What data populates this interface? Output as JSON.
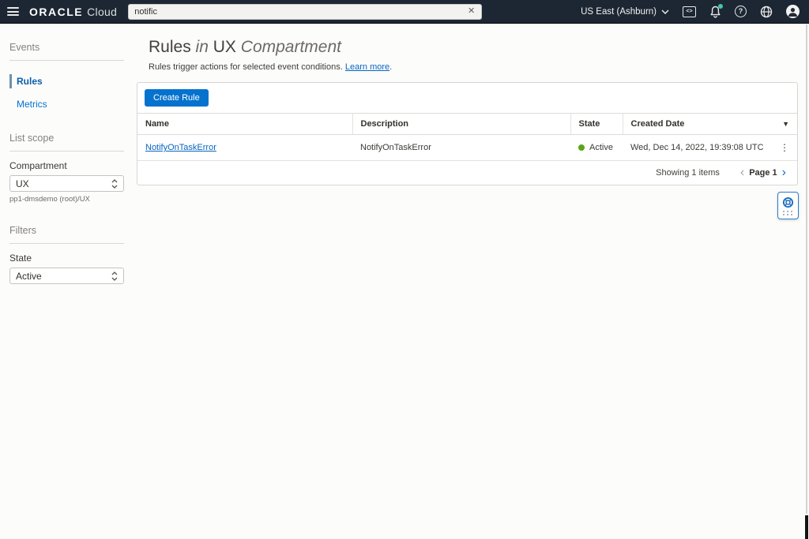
{
  "topbar": {
    "brand_bold": "ORACLE",
    "brand_light": "Cloud",
    "search": {
      "value": "notific"
    },
    "region_label": "US East (Ashburn)"
  },
  "sidebar": {
    "events_heading": "Events",
    "nav": [
      {
        "label": "Rules",
        "active": true
      },
      {
        "label": "Metrics",
        "active": false
      }
    ],
    "list_scope_heading": "List scope",
    "compartment_label": "Compartment",
    "compartment_value": "UX",
    "compartment_path": "pp1-dmsdemo (root)/UX",
    "filters_heading": "Filters",
    "state_label": "State",
    "state_value": "Active"
  },
  "main": {
    "title": {
      "rules": "Rules",
      "in": "in",
      "ux": "UX",
      "compartment": "Compartment"
    },
    "subtitle": "Rules trigger actions for selected event conditions.",
    "learn_more": "Learn more",
    "subtitle_suffix": ".",
    "create_button": "Create Rule",
    "table": {
      "columns": [
        "Name",
        "Description",
        "State",
        "Created Date"
      ],
      "rows": [
        {
          "name": "NotifyOnTaskError",
          "description": "NotifyOnTaskError",
          "state": "Active",
          "created": "Wed, Dec 14, 2022, 19:39:08 UTC"
        }
      ]
    },
    "pagination": {
      "showing": "Showing 1 items",
      "page": "Page 1"
    }
  },
  "glyphs": {
    "close": "✕",
    "kebab": "⋮",
    "sort_desc": "▼",
    "chevron_left": "‹",
    "chevron_right": "›",
    "question": "?",
    "code": "<>"
  },
  "colors": {
    "topbar_bg": "#1d2733",
    "accent_blue": "#0572ce",
    "link_blue": "#0765c1",
    "active_green": "#59a618",
    "notification_teal": "#3fc9ad"
  }
}
